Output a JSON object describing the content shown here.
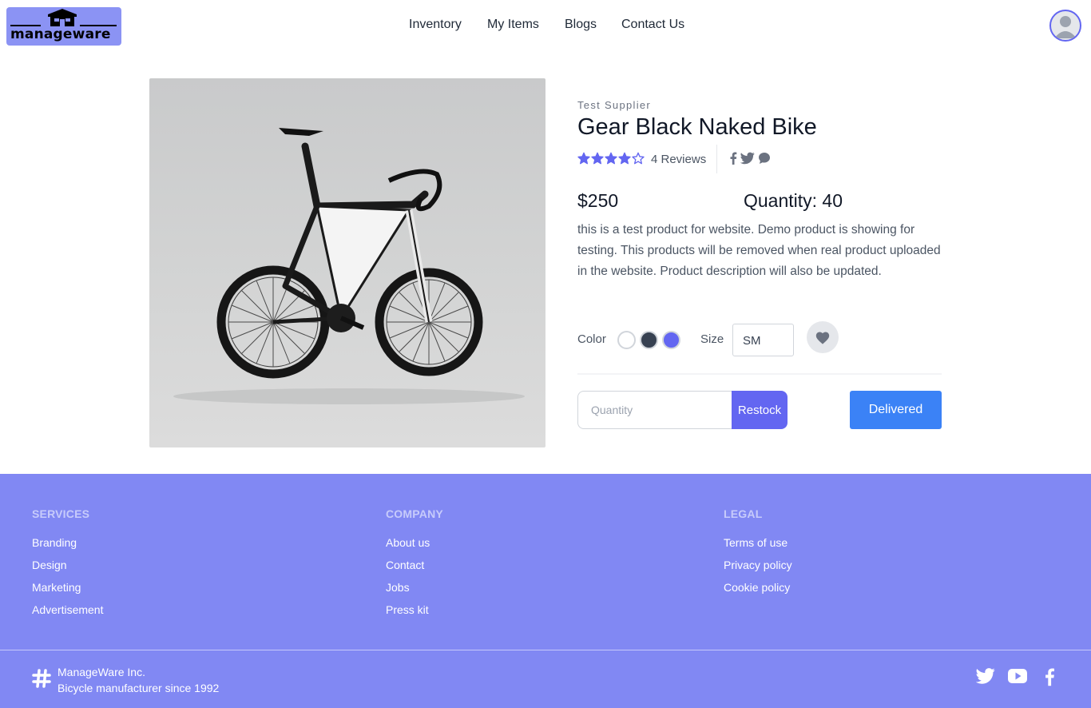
{
  "header": {
    "logo_text": "manageware",
    "nav": [
      {
        "label": "Inventory"
      },
      {
        "label": "My Items"
      },
      {
        "label": "Blogs"
      },
      {
        "label": "Contact Us"
      }
    ],
    "avatar_icon": "user-avatar-icon"
  },
  "product": {
    "supplier": "Test Supplier",
    "name": "Gear Black Naked Bike",
    "rating": 4,
    "rating_max": 5,
    "reviews": "4 Reviews",
    "share_icons": [
      "facebook-icon",
      "twitter-icon",
      "chat-icon"
    ],
    "price": "$250",
    "quantity": "Quantity: 40",
    "description": "this is a test product for website. Demo product is showing for testing. This products will be removed when real product uploaded in the website. Product description will also be updated.",
    "color_label": "Color",
    "colors": [
      "#ffffff",
      "#374151",
      "#6366f1"
    ],
    "size_label": "Size",
    "size_value": "SM",
    "quantity_placeholder": "Quantity",
    "restock_label": "Restock",
    "delivered_label": "Delivered"
  },
  "footer": {
    "columns": [
      {
        "heading": "SERVICES",
        "links": [
          "Branding",
          "Design",
          "Marketing",
          "Advertisement"
        ]
      },
      {
        "heading": "COMPANY",
        "links": [
          "About us",
          "Contact",
          "Jobs",
          "Press kit"
        ]
      },
      {
        "heading": "LEGAL",
        "links": [
          "Terms of use",
          "Privacy policy",
          "Cookie policy"
        ]
      }
    ],
    "company": "ManageWare Inc.",
    "tagline": "Bicycle manufacturer since 1992",
    "social_icons": [
      "twitter-icon",
      "youtube-icon",
      "facebook-icon"
    ]
  },
  "colors": {
    "accent": "#6366f1",
    "delivered": "#3b82f6",
    "footer_bg": "#8188f3",
    "logo_bg": "#8b93f4"
  }
}
